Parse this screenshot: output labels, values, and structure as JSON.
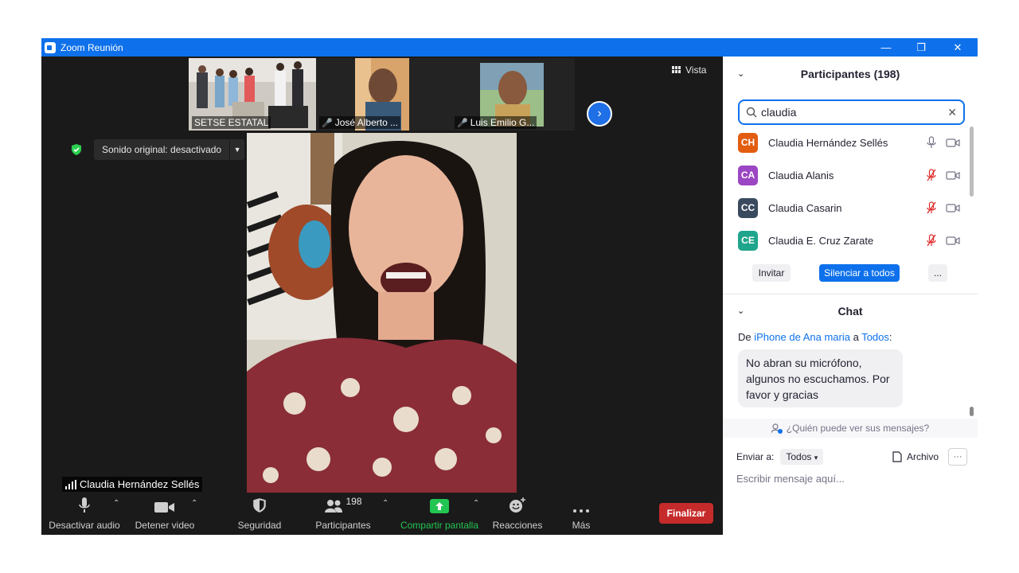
{
  "window": {
    "title": "Zoom Reunión",
    "minimize": "—",
    "restore": "❐",
    "close": "✕"
  },
  "thumbnails": [
    {
      "label": "SETSE ESTATAL",
      "muted": false
    },
    {
      "label": "José Alberto ...",
      "muted": true
    },
    {
      "label": "Luis Emilio G...",
      "muted": true
    }
  ],
  "next_arrow": "›",
  "vista_label": "Vista",
  "sound": {
    "label": "Sonido original: desactivado"
  },
  "speaker": {
    "name": "Claudia Hernández Sellés"
  },
  "toolbar": {
    "audio_label": "Desactivar audio",
    "video_label": "Detener video",
    "security_label": "Seguridad",
    "participants_label": "Participantes",
    "participants_count": "198",
    "share_label": "Compartir pantalla",
    "reactions_label": "Reacciones",
    "more_label": "Más",
    "end_label": "Finalizar"
  },
  "participants_panel": {
    "title": "Participantes (198)",
    "search_value": "claudia",
    "items": [
      {
        "initials": "CH",
        "name": "Claudia Hernández Sellés",
        "color": "#e35d10",
        "muted": false
      },
      {
        "initials": "CA",
        "name": "Claudia Alanis",
        "color": "#9b46c2",
        "muted": true
      },
      {
        "initials": "CC",
        "name": "Claudia Casarin",
        "color": "#3a4a5e",
        "muted": true
      },
      {
        "initials": "CE",
        "name": "Claudia E. Cruz Zarate",
        "color": "#1fa58b",
        "muted": true
      }
    ],
    "invite_label": "Invitar",
    "mute_all_label": "Silenciar a todos",
    "more_label": "..."
  },
  "chat_panel": {
    "title": "Chat",
    "message": {
      "prefix": "De",
      "sender": "iPhone de Ana maria",
      "connector": "a",
      "recipient": "Todos",
      "suffix": ":",
      "text": "No abran su micrófono, algunos no escuchamos. Por favor y gracias"
    },
    "who_can_see": "¿Quién puede ver sus mensajes?",
    "send_to_label": "Enviar a:",
    "send_to_value": "Todos",
    "file_label": "Archivo",
    "more_label": "···",
    "input_placeholder": "Escribir mensaje aquí..."
  },
  "colors": {
    "titlebar": "#0e71eb",
    "end_button": "#c62b2b",
    "share_green": "#23c552",
    "link_blue": "#0e71eb"
  }
}
